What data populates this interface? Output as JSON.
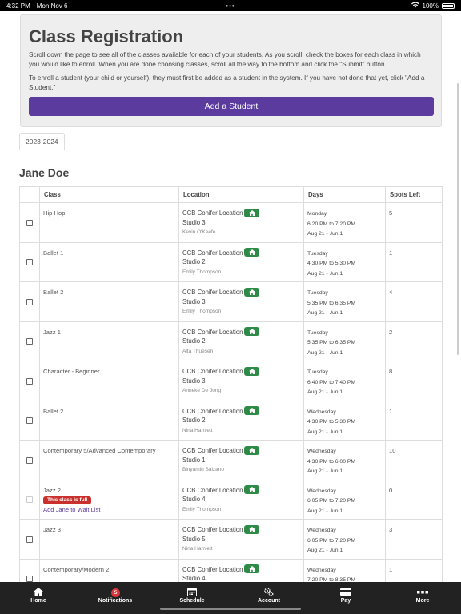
{
  "status_bar": {
    "time": "4:32 PM",
    "date": "Mon Nov 6",
    "dots": "•••",
    "battery": "100%"
  },
  "header": {
    "title": "Class Registration",
    "intro": "Scroll down the page to see all of the classes available for each of your students. As you scroll, check the boxes for each class in which you would like to enroll. When you are done choosing classes, scroll all the way to the bottom and click the \"Submit\" button.",
    "enroll_note": "To enroll a student (your child or yourself), they must first be added as a student in the system. If you have not done that yet, click \"Add a Student.\"",
    "add_student_label": "Add a Student"
  },
  "tabs": [
    {
      "label": "2023-2024"
    }
  ],
  "student_name": "Jane Doe",
  "table": {
    "headers": [
      "Class",
      "Location",
      "Days",
      "Spots Left"
    ],
    "rows": [
      {
        "class": "Hip Hop",
        "location": "CCB Conifer Location",
        "studio": "Studio 3",
        "instructor": "Kevin O'Keefe",
        "day": "Monday",
        "time": "6:20 PM to 7:20 PM",
        "dates": "Aug 21 - Jun 1",
        "spots": "5",
        "full": false
      },
      {
        "class": "Ballet 1",
        "location": "CCB Conifer Location",
        "studio": "Studio 2",
        "instructor": "Emily Thompson",
        "day": "Tuesday",
        "time": "4:30 PM to 5:30 PM",
        "dates": "Aug 21 - Jun 1",
        "spots": "1",
        "full": false
      },
      {
        "class": "Ballet 2",
        "location": "CCB Conifer Location",
        "studio": "Studio 3",
        "instructor": "Emily Thompson",
        "day": "Tuesday",
        "time": "5:35 PM to 6:35 PM",
        "dates": "Aug 21 - Jun 1",
        "spots": "4",
        "full": false
      },
      {
        "class": "Jazz 1",
        "location": "CCB Conifer Location",
        "studio": "Studio 2",
        "instructor": "Alta Thuesen",
        "day": "Tuesday",
        "time": "5:35 PM to 6:35 PM",
        "dates": "Aug 21 - Jun 1",
        "spots": "2",
        "full": false
      },
      {
        "class": "Character - Beginner",
        "location": "CCB Conifer Location",
        "studio": "Studio 3",
        "instructor": "Anneke De Jong",
        "day": "Tuesday",
        "time": "6:40 PM to 7:40 PM",
        "dates": "Aug 21 - Jun 1",
        "spots": "8",
        "full": false
      },
      {
        "class": "Ballet 2",
        "location": "CCB Conifer Location",
        "studio": "Studio 2",
        "instructor": "Nina Hamlett",
        "day": "Wednesday",
        "time": "4:30 PM to 5:30 PM",
        "dates": "Aug 21 - Jun 1",
        "spots": "1",
        "full": false
      },
      {
        "class": "Contemporary 5/Advanced Contemporary",
        "location": "CCB Conifer Location",
        "studio": "Studio 1",
        "instructor": "Binyamin Salzano",
        "day": "Wednesday",
        "time": "4:30 PM to 6:00 PM",
        "dates": "Aug 21 - Jun 1",
        "spots": "10",
        "full": false
      },
      {
        "class": "Jazz 2",
        "location": "CCB Conifer Location",
        "studio": "Studio 4",
        "instructor": "Emily Thompson",
        "day": "Wednesday",
        "time": "6:05 PM to 7:20 PM",
        "dates": "Aug 21 - Jun 1",
        "spots": "0",
        "full": true,
        "full_label": "This class is full",
        "waitlist_label": "Add Jane to Wait List"
      },
      {
        "class": "Jazz 3",
        "location": "CCB Conifer Location",
        "studio": "Studio 5",
        "instructor": "Nina Hamlett",
        "day": "Wednesday",
        "time": "6:05 PM to 7:20 PM",
        "dates": "Aug 21 - Jun 1",
        "spots": "3",
        "full": false
      },
      {
        "class": "Contemporary/Modern 2",
        "location": "CCB Conifer Location",
        "studio": "Studio 4",
        "instructor": "",
        "day": "Wednesday",
        "time": "7:20 PM to 8:35 PM",
        "dates": "",
        "spots": "1",
        "full": false
      }
    ]
  },
  "bottom_nav": [
    {
      "label": "Home",
      "icon": "home-icon"
    },
    {
      "label": "Notifications",
      "icon": "bell-icon",
      "badge": "5"
    },
    {
      "label": "Schedule",
      "icon": "calendar-icon"
    },
    {
      "label": "Account",
      "icon": "gears-icon"
    },
    {
      "label": "Pay",
      "icon": "credit-card-icon"
    },
    {
      "label": "More",
      "icon": "more-icon"
    }
  ],
  "colors": {
    "accent": "#5b3b9e",
    "home_badge": "#2e8b47",
    "full_badge": "#c9302c",
    "nav_bg": "#222222"
  }
}
